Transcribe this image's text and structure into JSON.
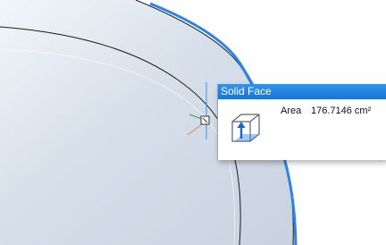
{
  "tooltip": {
    "title": "Solid Face",
    "area_label": "Area",
    "area_value": "176.7146 cm²"
  },
  "icons": {
    "face": "solid-face-icon",
    "snap": "snap-marker-icon",
    "axes": "axis-triad-icon"
  },
  "colors": {
    "selected_edge": "#2e84e6",
    "body_fill": "#d4dde8",
    "tooltip_title": "#1f7fdc"
  }
}
